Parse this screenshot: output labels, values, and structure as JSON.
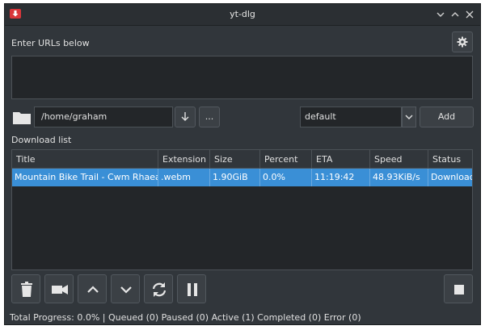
{
  "window": {
    "title": "yt-dlg"
  },
  "urls": {
    "label": "Enter URLs below",
    "value": ""
  },
  "path": {
    "value": "/home/graham",
    "browse_label": "..."
  },
  "format": {
    "selected": "default"
  },
  "add_label": "Add",
  "download_list": {
    "label": "Download list",
    "columns": [
      "Title",
      "Extension",
      "Size",
      "Percent",
      "ETA",
      "Speed",
      "Status"
    ],
    "rows": [
      {
        "title": "Mountain Bike Trail - Cwm Rhaeadr...",
        "extension": ".webm",
        "size": "1.90GiB",
        "percent": "0.0%",
        "eta": "11:19:42",
        "speed": "48.93KiB/s",
        "status": "Downloading"
      }
    ]
  },
  "status_text": "Total Progress: 0.0% | Queued (0) Paused (0) Active (1) Completed (0) Error (0)",
  "colors": {
    "accent": "#3a8fd6",
    "background": "#31363b",
    "app_icon": "#d9363a"
  },
  "icons": [
    "app-icon",
    "chevron-down-icon",
    "chevron-up-icon",
    "close-icon",
    "gear-icon",
    "folder-icon",
    "arrow-down-icon",
    "trash-icon",
    "video-camera-icon",
    "reload-icon",
    "pause-icon",
    "stop-icon"
  ]
}
